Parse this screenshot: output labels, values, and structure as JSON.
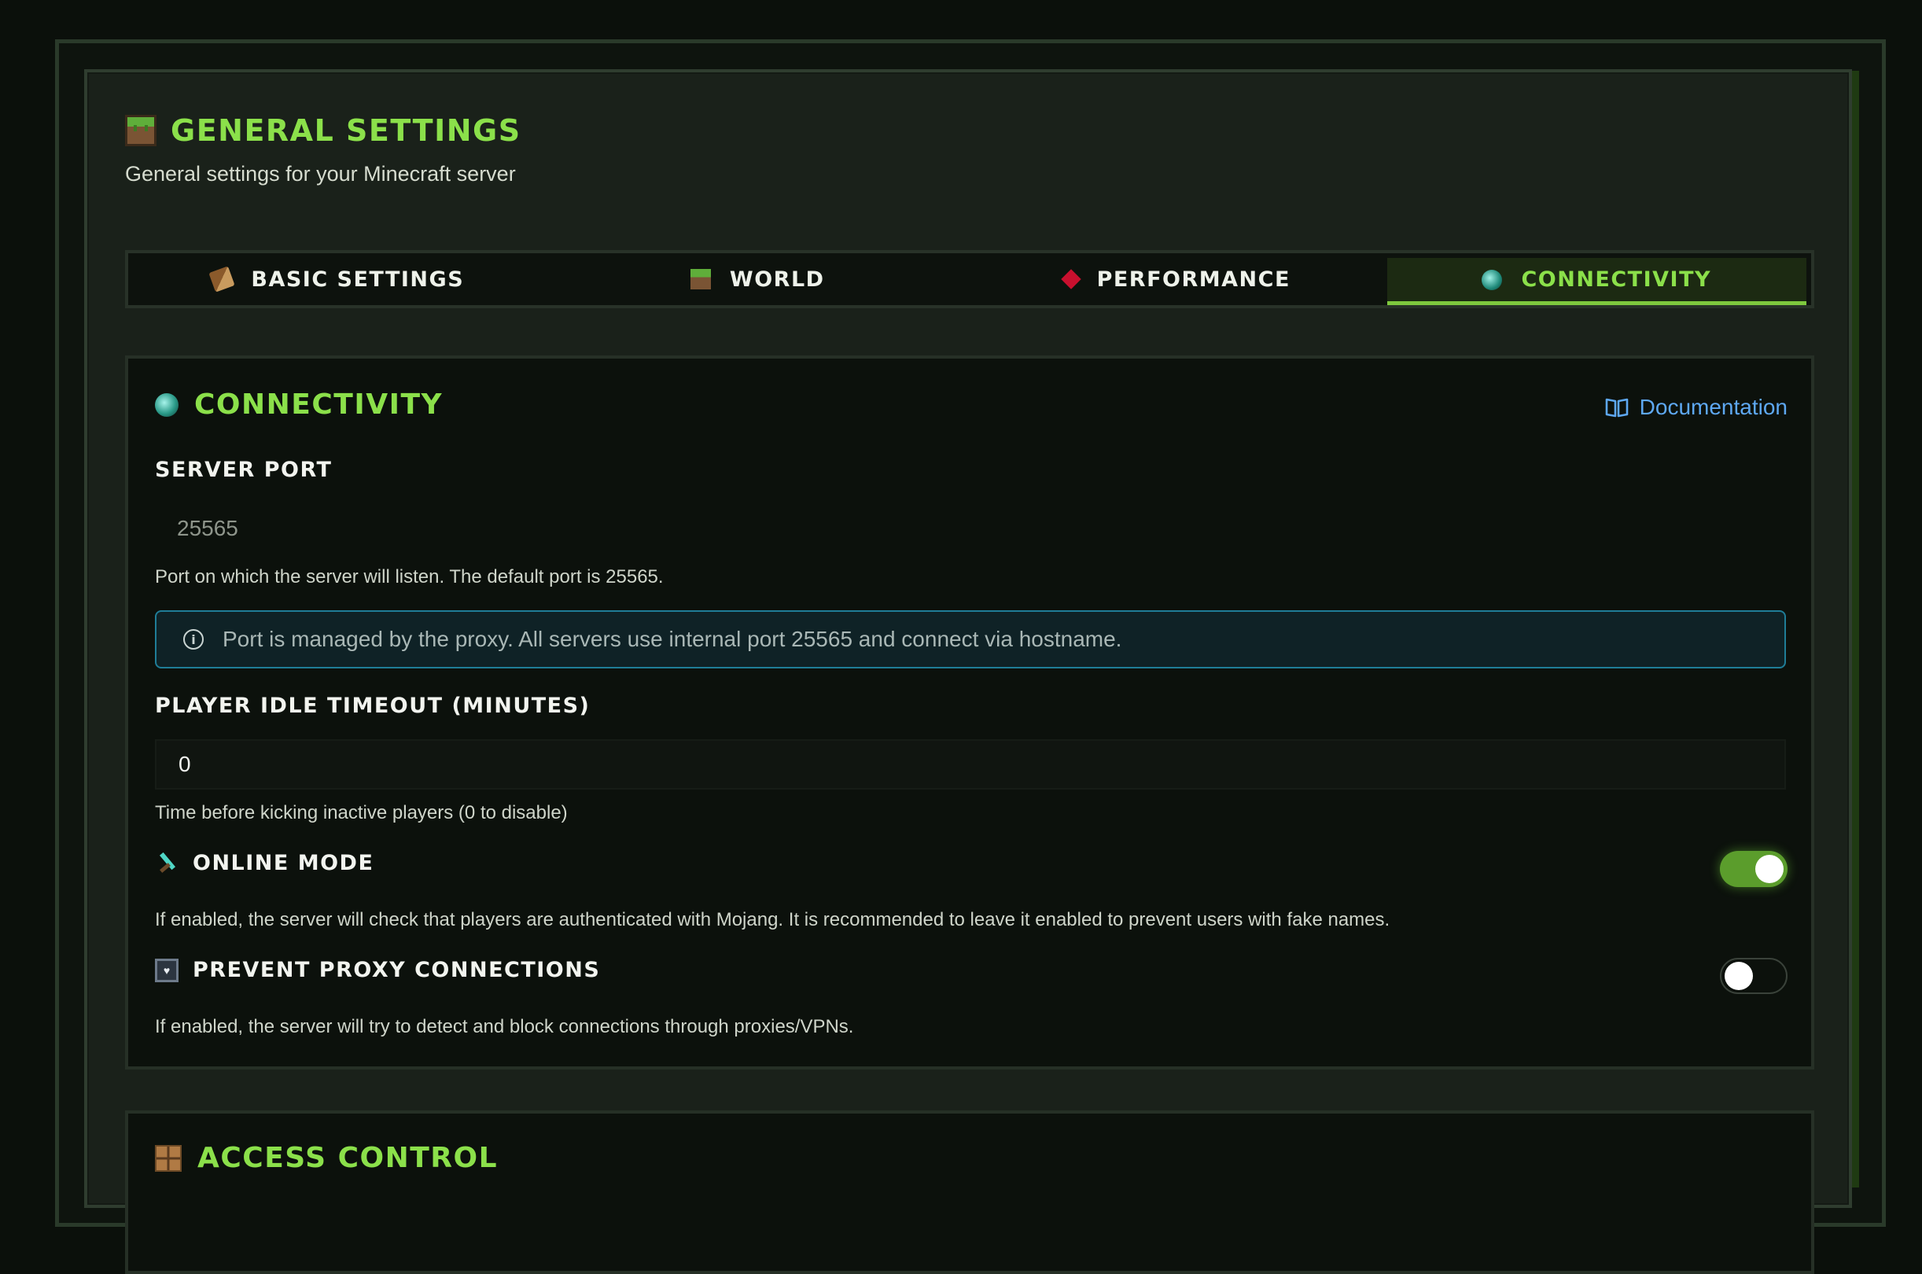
{
  "header": {
    "title": "GENERAL SETTINGS",
    "subtitle": "General settings for your Minecraft server"
  },
  "tabs": [
    {
      "label": "BASIC SETTINGS",
      "icon": "book-icon",
      "active": false
    },
    {
      "label": "WORLD",
      "icon": "grass-block-icon",
      "active": false
    },
    {
      "label": "PERFORMANCE",
      "icon": "redstone-icon",
      "active": false
    },
    {
      "label": "CONNECTIVITY",
      "icon": "ender-pearl-icon",
      "active": true
    }
  ],
  "connectivity": {
    "title": "CONNECTIVITY",
    "documentation_label": "Documentation",
    "server_port": {
      "label": "SERVER PORT",
      "value": "25565",
      "help": "Port on which the server will listen. The default port is 25565.",
      "info": "Port is managed by the proxy. All servers use internal port 25565 and connect via hostname."
    },
    "idle_timeout": {
      "label": "PLAYER IDLE TIMEOUT (MINUTES)",
      "value": "0",
      "help": "Time before kicking inactive players (0 to disable)"
    },
    "online_mode": {
      "label": "ONLINE MODE",
      "enabled": true,
      "help": "If enabled, the server will check that players are authenticated with Mojang. It is recommended to leave it enabled to prevent users with fake names."
    },
    "prevent_proxy": {
      "label": "PREVENT PROXY CONNECTIONS",
      "enabled": false,
      "help": "If enabled, the server will try to detect and block connections through proxies/VPNs."
    }
  },
  "access_control": {
    "title": "ACCESS CONTROL"
  },
  "colors": {
    "accent_green": "#8be04a",
    "link_blue": "#5ea8f2",
    "info_border": "#1f7d97",
    "toggle_on": "#5b9d2c"
  }
}
